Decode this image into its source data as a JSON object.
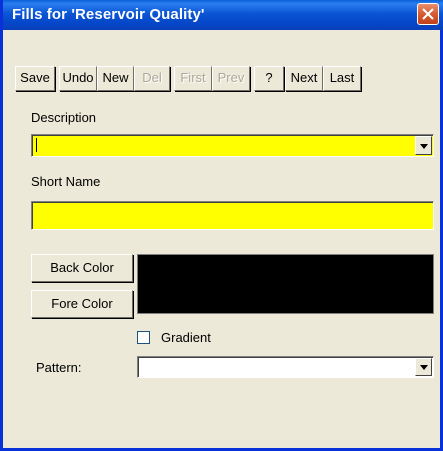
{
  "window": {
    "title": "Fills for 'Reservoir Quality'"
  },
  "toolbar": {
    "save": "Save",
    "undo": "Undo",
    "new": "New",
    "del": "Del",
    "first": "First",
    "prev": "Prev",
    "help": "?",
    "next": "Next",
    "last": "Last"
  },
  "form": {
    "description_label": "Description",
    "description_value": "",
    "short_name_label": "Short Name",
    "short_name_value": "",
    "back_color_label": "Back Color",
    "fore_color_label": "Fore Color",
    "gradient_label": "Gradient",
    "gradient_checked": false,
    "pattern_label": "Pattern:",
    "pattern_value": ""
  },
  "colors": {
    "field_background": "#ffff00",
    "swatch_color": "#000000",
    "titlebar": "#0a55d4"
  },
  "icons": {
    "close": "close-icon",
    "dropdown": "chevron-down-icon"
  }
}
